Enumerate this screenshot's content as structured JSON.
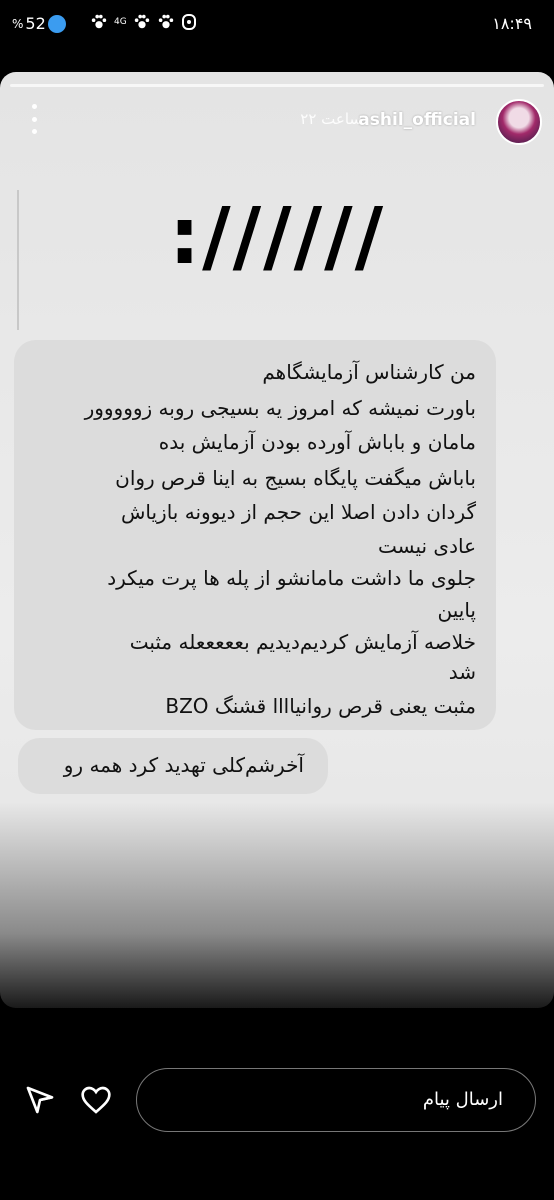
{
  "statusbar": {
    "time": "۱۸:۴۹",
    "battery": "52",
    "battery_symbol": "%",
    "network": "4G"
  },
  "story": {
    "username": "ashil_official",
    "time_ago": "۲۲ ساعت",
    "big_text": "://////",
    "message_lines": [
      "من کارشناس آزمایشگاهم",
      "باورت نمیشه که امروز یه بسیجی روبه زووووور",
      "مامان و باباش آورده بودن آزمایش بده",
      "باباش میگفت پایگاه بسیج به اینا قرص روان",
      "گردان دادن اصلا این حجم از دیوونه بازیاش",
      "عادی نیست",
      "جلوی ما داشت مامانشو از پله ها پرت میکرد",
      "پایین",
      "خلاصه آزمایش کردیم‌دیدیم بعععععله مثبت",
      "شد",
      "مثبت یعنی قرص روانیاااا قشنگ BZO"
    ],
    "message2": "آخرشم‌کلی تهدید کرد همه رو"
  },
  "bottom": {
    "message_placeholder": "ارسال پیام"
  }
}
